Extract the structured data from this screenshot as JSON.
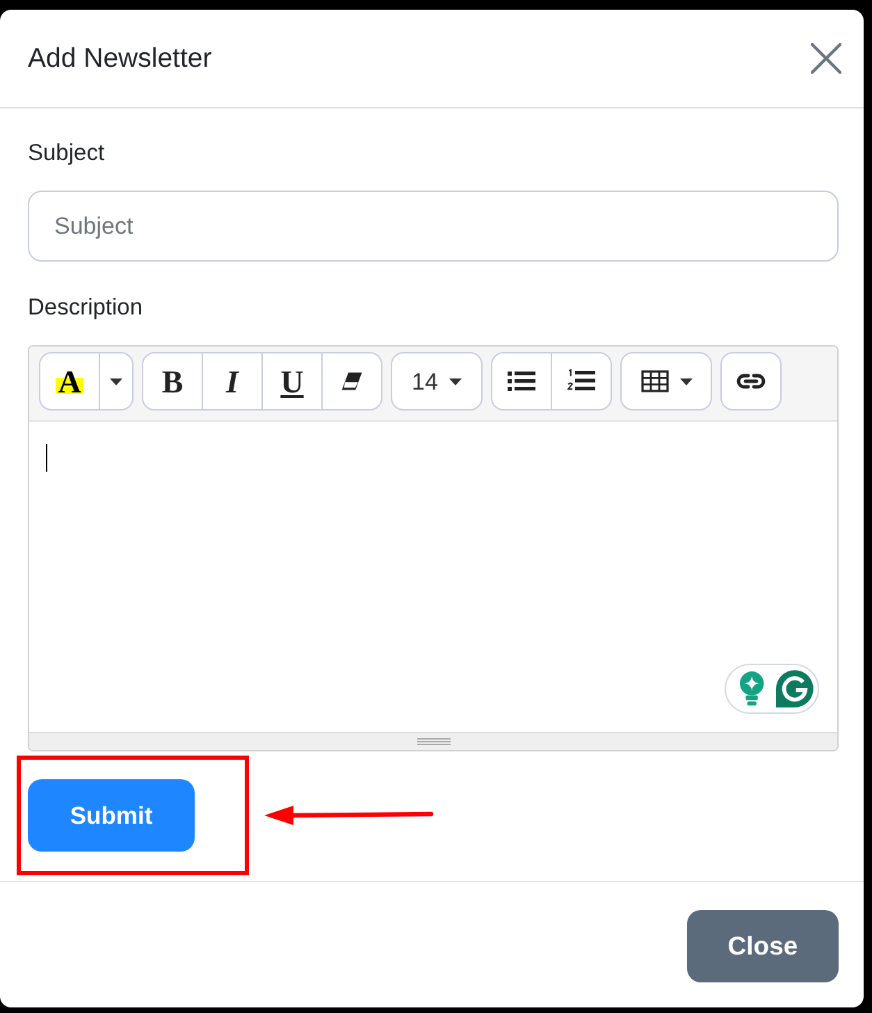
{
  "dialog": {
    "title": "Add Newsletter"
  },
  "subject": {
    "label": "Subject",
    "placeholder": "Subject"
  },
  "description": {
    "label": "Description",
    "focused": true,
    "toolbar": [
      [
        {
          "kind": "color",
          "glyph": "A"
        },
        {
          "kind": "menu"
        }
      ],
      [
        {
          "kind": "bold",
          "glyph": "B"
        },
        {
          "kind": "italic",
          "glyph": "I"
        },
        {
          "kind": "underline",
          "glyph": "U"
        },
        {
          "kind": "eraser"
        }
      ],
      [
        {
          "kind": "size",
          "value": "14"
        }
      ],
      [
        {
          "kind": "bullets"
        },
        {
          "kind": "numbers"
        }
      ],
      [
        {
          "kind": "table"
        }
      ],
      [
        {
          "kind": "link"
        }
      ]
    ]
  },
  "submit": {
    "label": "Submit",
    "highlighted": true
  },
  "footer": {
    "buttons": [
      {
        "label": "Close"
      }
    ]
  }
}
